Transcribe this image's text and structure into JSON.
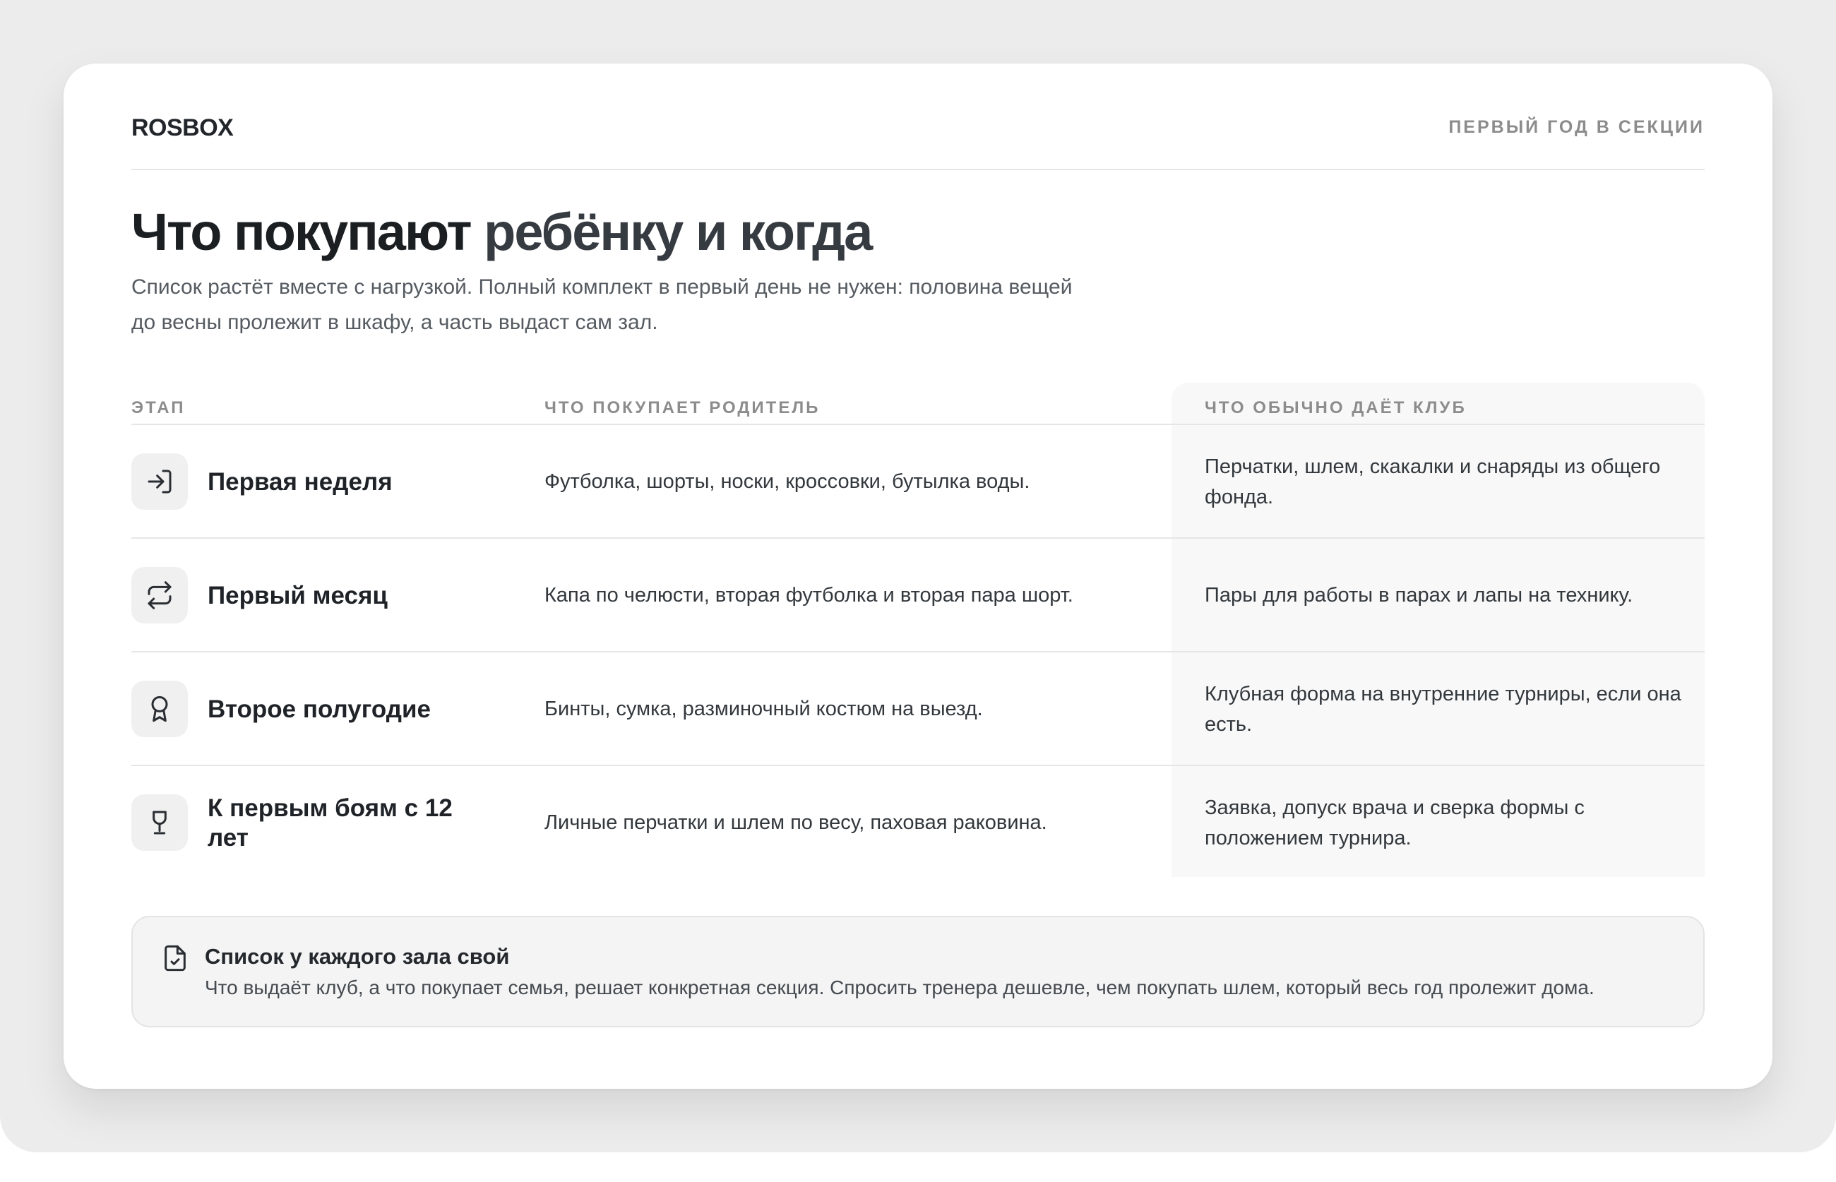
{
  "brand": "ROSBOX",
  "eyebrow": "ПЕРВЫЙ ГОД В СЕКЦИИ",
  "title": {
    "strong": "Что покупают",
    "soft": " ребёнку и когда"
  },
  "lead": "Список растёт вместе с нагрузкой. Полный комплект в первый день не нужен: половина вещей до весны пролежит в шкафу, а часть выдаст сам зал.",
  "table": {
    "headers": {
      "stage": "ЭТАП",
      "parent": "ЧТО ПОКУПАЕТ РОДИТЕЛЬ",
      "club": "ЧТО ОБЫЧНО ДАЁТ КЛУБ"
    },
    "rows": [
      {
        "icon": "enter-icon",
        "stage": "Первая неделя",
        "parent": "Футболка, шорты, носки, кроссовки, бутылка воды.",
        "club": "Перчатки, шлем, скакалки и снаряды из общего фонда."
      },
      {
        "icon": "repeat-icon",
        "stage": "Первый месяц",
        "parent": "Капа по челюсти, вторая футболка и вторая пара шорт.",
        "club": "Пары для работы в парах и лапы на технику."
      },
      {
        "icon": "award-icon",
        "stage": "Второе полугодие",
        "parent": "Бинты, сумка, разминочный костюм на выезд.",
        "club": "Клубная форма на внутренние турниры, если она есть."
      },
      {
        "icon": "trophy-icon",
        "stage": "К первым боям с 12 лет",
        "parent": "Личные перчатки и шлем по весу, паховая раковина.",
        "club": "Заявка, допуск врача и сверка формы с положением турнира."
      }
    ]
  },
  "note": {
    "icon": "file-check-icon",
    "title": "Список у каждого зала свой",
    "text": "Что выдаёт клуб, а что покупает семья, решает конкретная секция. Спросить тренера дешевле, чем покупать шлем, который весь год пролежит дома."
  }
}
